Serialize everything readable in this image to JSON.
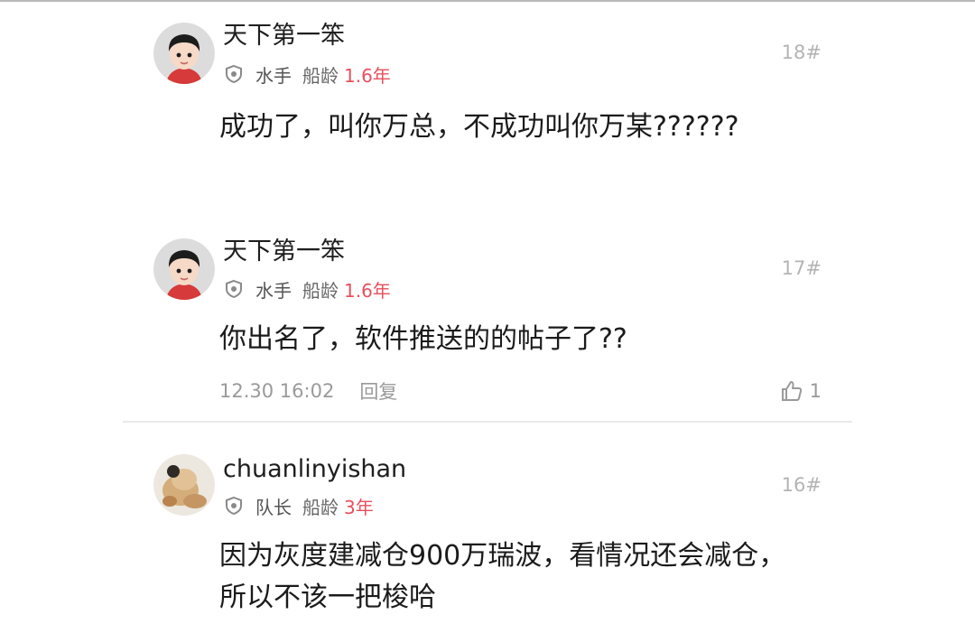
{
  "posts": [
    {
      "username": "天下第一笨",
      "role": "水手",
      "age_label": "船龄",
      "age_value": "1.6年",
      "floor": "18#",
      "content": "成功了，叫你万总，不成功叫你万某??????",
      "avatar_icon": "cartoon-boy-avatar"
    },
    {
      "username": "天下第一笨",
      "role": "水手",
      "age_label": "船龄",
      "age_value": "1.6年",
      "floor": "17#",
      "content": "你出名了，软件推送的的帖子了??",
      "time": "12.30 16:02",
      "reply_label": "回复",
      "like_count": "1",
      "avatar_icon": "cartoon-boy-avatar"
    },
    {
      "username": "chuanlinyishan",
      "role": "队长",
      "age_label": "船龄",
      "age_value": "3年",
      "floor": "16#",
      "content": "因为灰度建减仓900万瑞波，看情况还会减仓，所以不该一把梭哈",
      "avatar_icon": "photo-avatar"
    }
  ],
  "icons": {
    "badge": "shield-badge-icon",
    "like": "thumbs-up-icon"
  },
  "colors": {
    "age_value": "#e8505b",
    "floor": "#b4b4b4",
    "divider": "#e9e9e9"
  }
}
